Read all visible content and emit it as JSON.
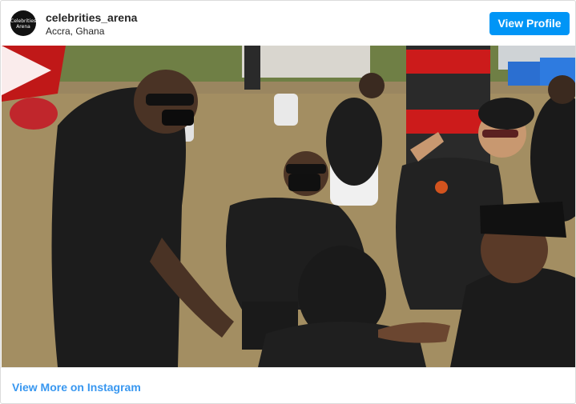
{
  "header": {
    "avatar_text": "Celebrities Arena",
    "username": "celebrities_arena",
    "location": "Accra, Ghana",
    "view_profile_label": "View Profile"
  },
  "media": {
    "type": "video",
    "play_icon": "play-icon"
  },
  "footer": {
    "more_link_label": "View More on Instagram"
  },
  "colors": {
    "accent": "#0095f6",
    "link": "#3897f0",
    "text": "#262626"
  }
}
